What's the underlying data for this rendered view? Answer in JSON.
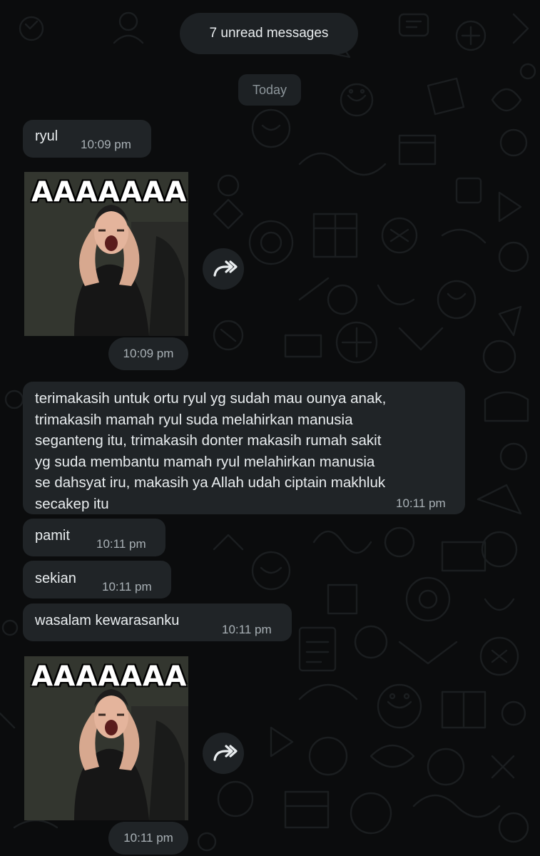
{
  "banner": {
    "unread": "7 unread messages"
  },
  "date_chip": "Today",
  "messages": [
    {
      "text": "ryul",
      "time": "10:09 pm"
    },
    {
      "sticker_caption": "AAAAAAA",
      "time": "10:09 pm"
    },
    {
      "lines": [
        "terimakasih untuk ortu ryul yg sudah mau ounya anak,",
        "trimakasih mamah ryul suda melahirkan manusia",
        "seganteng itu, trimakasih donter makasih rumah sakit",
        "yg suda membantu mamah ryul melahirkan manusia",
        "se dahsyat iru, makasih ya Allah udah ciptain makhluk",
        "secakep itu"
      ],
      "time": "10:11 pm"
    },
    {
      "text": "pamit",
      "time": "10:11 pm"
    },
    {
      "text": "sekian",
      "time": "10:11 pm"
    },
    {
      "text": "wasalam kewarasanku",
      "time": "10:11 pm"
    },
    {
      "sticker_caption": "AAAAAAA",
      "time": "10:11 pm"
    }
  ],
  "icons": {
    "forward": "forward-share-icon"
  },
  "colors": {
    "background": "#0b0c0d",
    "bubble": "#202427",
    "text": "#e9edef",
    "meta": "#a9b1b6"
  }
}
